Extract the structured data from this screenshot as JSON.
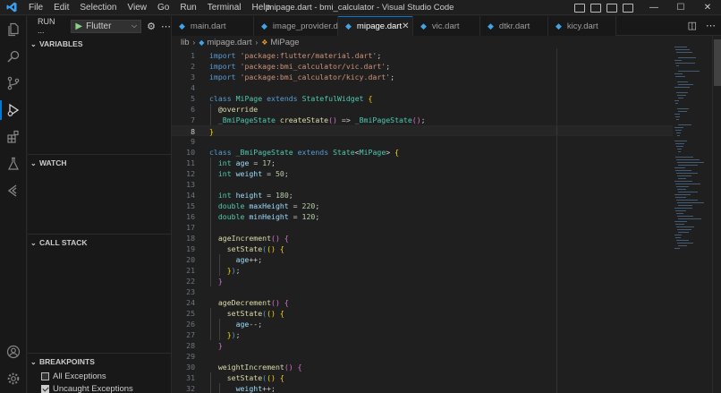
{
  "window": {
    "title": "mipage.dart - bmi_calculator - Visual Studio Code",
    "menu": [
      "File",
      "Edit",
      "Selection",
      "View",
      "Go",
      "Run",
      "Terminal",
      "Help"
    ],
    "controls": {
      "minimize": "—",
      "maximize": "☐",
      "close": "✕"
    }
  },
  "sidebar": {
    "run_label": "RUN ...",
    "config_name": "Flutter",
    "sections": {
      "variables": "VARIABLES",
      "watch": "WATCH",
      "call_stack": "CALL STACK",
      "breakpoints": "BREAKPOINTS"
    },
    "breakpoints": [
      {
        "label": "All Exceptions",
        "checked": false
      },
      {
        "label": "Uncaught Exceptions",
        "checked": true
      }
    ]
  },
  "tabs": [
    {
      "label": "main.dart",
      "active": false
    },
    {
      "label": "image_provider.dart",
      "active": false
    },
    {
      "label": "mipage.dart",
      "active": true
    },
    {
      "label": "vic.dart",
      "active": false
    },
    {
      "label": "dtkr.dart",
      "active": false
    },
    {
      "label": "kicy.dart",
      "active": false
    }
  ],
  "breadcrumb": {
    "folder": "lib",
    "file": "mipage.dart",
    "symbol": "MiPage"
  },
  "editor": {
    "current_line": 8,
    "lines": [
      {
        "n": "1",
        "html": "<span class='kw'>import</span> <span class='str'>'package:flutter/material.dart'</span>;"
      },
      {
        "n": "2",
        "html": "<span class='kw'>import</span> <span class='str'>'package:bmi_calculator/vic.dart'</span>;"
      },
      {
        "n": "3",
        "html": "<span class='kw'>import</span> <span class='str'>'package:bmi_calculator/kicy.dart'</span>;"
      },
      {
        "n": "4",
        "html": ""
      },
      {
        "n": "5",
        "html": "<span class='kw'>class</span> <span class='cls'>MiPage</span> <span class='kw'>extends</span> <span class='cls'>StatefulWidget</span> <span class='brk'>{</span>"
      },
      {
        "n": "6",
        "html": "  <span class='ann'>@override</span>"
      },
      {
        "n": "7",
        "html": "  <span class='cls'>_BmiPageState</span> <span class='fn'>createState</span><span class='brk2'>()</span> => <span class='cls'>_BmiPageState</span><span class='brk2'>()</span>;"
      },
      {
        "n": "8",
        "html": "<span class='brk'>}</span>"
      },
      {
        "n": "9",
        "html": ""
      },
      {
        "n": "10",
        "html": "<span class='kw'>class</span> <span class='cls'>_BmiPageState</span> <span class='kw'>extends</span> <span class='cls'>State</span>&lt;<span class='cls'>MiPage</span>&gt; <span class='brk'>{</span>"
      },
      {
        "n": "11",
        "html": "  <span class='cls'>int</span> <span class='var'>age</span> = <span class='num'>17</span>;"
      },
      {
        "n": "12",
        "html": "  <span class='cls'>int</span> <span class='var'>weight</span> = <span class='num'>50</span>;"
      },
      {
        "n": "13",
        "html": ""
      },
      {
        "n": "14",
        "html": "  <span class='cls'>int</span> <span class='var'>height</span> = <span class='num'>180</span>;"
      },
      {
        "n": "15",
        "html": "  <span class='cls'>double</span> <span class='var'>maxHeight</span> = <span class='num'>220</span>;"
      },
      {
        "n": "16",
        "html": "  <span class='cls'>double</span> <span class='var'>minHeight</span> = <span class='num'>120</span>;"
      },
      {
        "n": "17",
        "html": ""
      },
      {
        "n": "18",
        "html": "  <span class='fn'>ageIncrement</span><span class='brk2'>()</span> <span class='brk2'>{</span>"
      },
      {
        "n": "19",
        "html": "    <span class='fn'>setState</span><span class='kw'>(</span><span class='brk'>()</span> <span class='brk'>{</span>"
      },
      {
        "n": "20",
        "html": "      <span class='var'>age</span>++;"
      },
      {
        "n": "21",
        "html": "    <span class='brk'>}</span><span class='kw'>)</span>;"
      },
      {
        "n": "22",
        "html": "  <span class='brk2'>}</span>"
      },
      {
        "n": "23",
        "html": ""
      },
      {
        "n": "24",
        "html": "  <span class='fn'>ageDecrement</span><span class='brk2'>()</span> <span class='brk2'>{</span>"
      },
      {
        "n": "25",
        "html": "    <span class='fn'>setState</span><span class='kw'>(</span><span class='brk'>()</span> <span class='brk'>{</span>"
      },
      {
        "n": "26",
        "html": "      <span class='var'>age</span>--;"
      },
      {
        "n": "27",
        "html": "    <span class='brk'>}</span><span class='kw'>)</span>;"
      },
      {
        "n": "28",
        "html": "  <span class='brk2'>}</span>"
      },
      {
        "n": "29",
        "html": ""
      },
      {
        "n": "30",
        "html": "  <span class='fn'>weightIncrement</span><span class='brk2'>()</span> <span class='brk2'>{</span>"
      },
      {
        "n": "31",
        "html": "    <span class='fn'>setState</span><span class='kw'>(</span><span class='brk'>()</span> <span class='brk'>{</span>"
      },
      {
        "n": "32",
        "html": "      <span class='var'>weight</span>++;"
      }
    ]
  }
}
